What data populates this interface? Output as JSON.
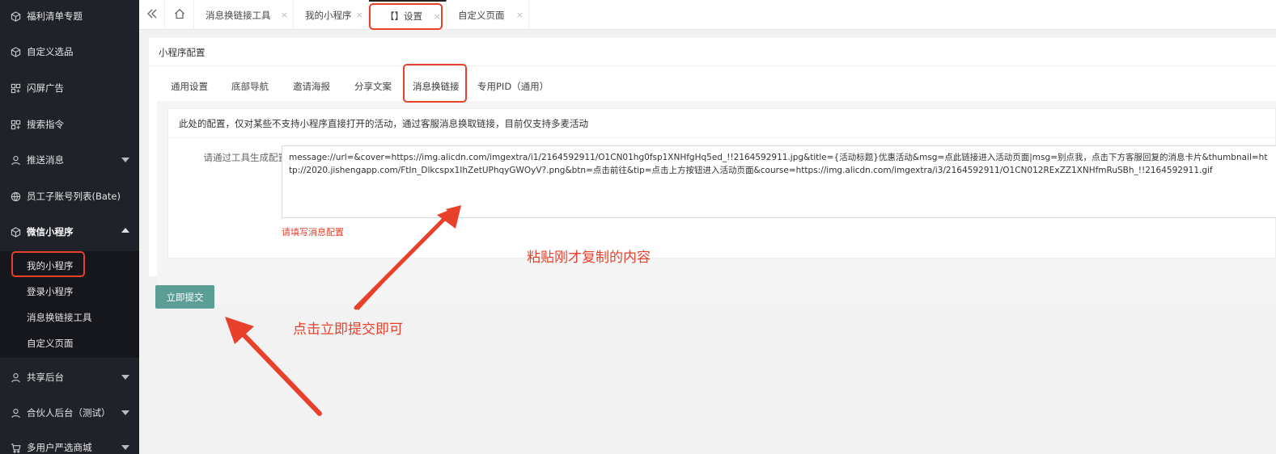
{
  "sidebar": {
    "items": [
      {
        "label": "福利清单专题",
        "icon": "box-icon"
      },
      {
        "label": "自定义选品",
        "icon": "box-icon"
      },
      {
        "label": "闪屏广告",
        "icon": "grid-icon"
      },
      {
        "label": "搜索指令",
        "icon": "grid-icon"
      },
      {
        "label": "推送消息",
        "icon": "user-icon"
      },
      {
        "label": "员工子账号列表(Bate)",
        "icon": "globe-icon"
      },
      {
        "label": "微信小程序",
        "icon": "box-icon"
      },
      {
        "label": "共享后台",
        "icon": "user-icon"
      },
      {
        "label": "合伙人后台（测试）",
        "icon": "user-icon"
      },
      {
        "label": "多用户严选商城",
        "icon": "cart-icon"
      }
    ],
    "submenu": [
      {
        "label": "我的小程序"
      },
      {
        "label": "登录小程序"
      },
      {
        "label": "消息换链接工具"
      },
      {
        "label": "自定义页面"
      }
    ]
  },
  "tabs": [
    {
      "label": "消息换链接工具"
    },
    {
      "label": "我的小程序"
    },
    {
      "label": "【】设置"
    },
    {
      "label": "自定义页面"
    }
  ],
  "tab_close": "×",
  "panel": {
    "title": "小程序配置",
    "subtabs": [
      "通用设置",
      "底部导航",
      "邀请海报",
      "分享文案",
      "消息换链接",
      "专用PID（通用）"
    ],
    "notice": "此处的配置，仅对某些不支持小程序直接打开的活动，通过客服消息换取链接，目前仅支持多麦活动",
    "field_label": "请通过工具生成配置",
    "field_value": "message://url=&cover=https://img.alicdn.com/imgextra/i1/2164592911/O1CN01hg0fsp1XNHfgHq5ed_!!2164592911.jpg&title={活动标题}优惠活动&msg=点此链接进入活动页面|msg=别点我，点击下方客服回复的消息卡片&thumbnail=http://2020.jishengapp.com/FtIn_Dlkcspx1IhZetUPhqyGWOyV?.png&btn=点击前往&tip=点击上方按钮进入活动页面&course=https://img.alicdn.com/imgextra/i3/2164592911/O1CN012RExZZ1XNHfmRuSBh_!!2164592911.gif",
    "field_error": "请填写消息配置"
  },
  "submit_label": "立即提交",
  "annotations": {
    "paste": "粘贴刚才复制的内容",
    "click": "点击立即提交即可"
  },
  "colors": {
    "sidebar_bg": "#20222a",
    "highlight": "#e8402b",
    "submit": "#5a9e95"
  }
}
